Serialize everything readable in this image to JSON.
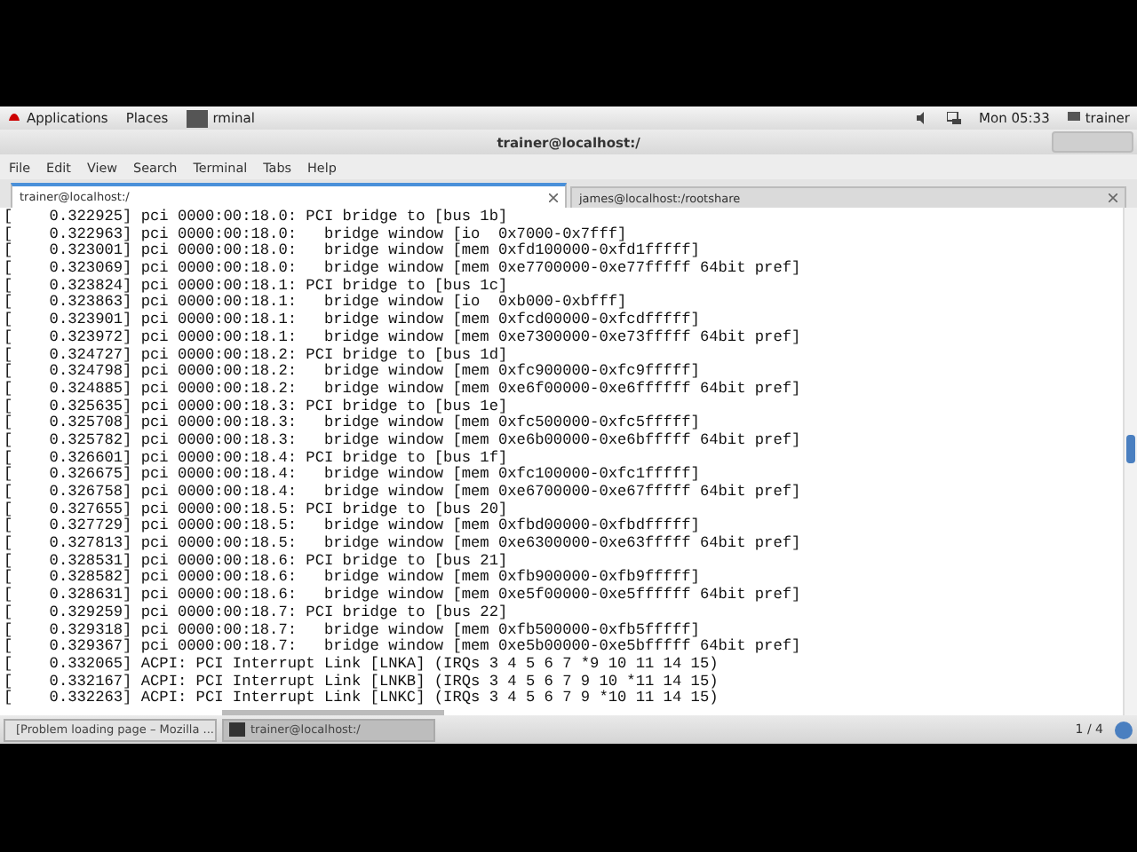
{
  "top_bar": {
    "applications": "Applications",
    "places": "Places",
    "active_app": "rminal",
    "clock": "Mon 05:33",
    "user": "trainer"
  },
  "window": {
    "title": "trainer@localhost:/"
  },
  "menu": [
    "File",
    "Edit",
    "View",
    "Search",
    "Terminal",
    "Tabs",
    "Help"
  ],
  "tabs": [
    {
      "label": "trainer@localhost:/",
      "selected": true
    },
    {
      "label": "james@localhost:/rootshare",
      "selected": false
    }
  ],
  "terminal_lines": [
    "[    0.322925] pci 0000:00:18.0: PCI bridge to [bus 1b]",
    "[    0.322963] pci 0000:00:18.0:   bridge window [io  0x7000-0x7fff]",
    "[    0.323001] pci 0000:00:18.0:   bridge window [mem 0xfd100000-0xfd1fffff]",
    "[    0.323069] pci 0000:00:18.0:   bridge window [mem 0xe7700000-0xe77fffff 64bit pref]",
    "[    0.323824] pci 0000:00:18.1: PCI bridge to [bus 1c]",
    "[    0.323863] pci 0000:00:18.1:   bridge window [io  0xb000-0xbfff]",
    "[    0.323901] pci 0000:00:18.1:   bridge window [mem 0xfcd00000-0xfcdfffff]",
    "[    0.323972] pci 0000:00:18.1:   bridge window [mem 0xe7300000-0xe73fffff 64bit pref]",
    "[    0.324727] pci 0000:00:18.2: PCI bridge to [bus 1d]",
    "[    0.324798] pci 0000:00:18.2:   bridge window [mem 0xfc900000-0xfc9fffff]",
    "[    0.324885] pci 0000:00:18.2:   bridge window [mem 0xe6f00000-0xe6ffffff 64bit pref]",
    "[    0.325635] pci 0000:00:18.3: PCI bridge to [bus 1e]",
    "[    0.325708] pci 0000:00:18.3:   bridge window [mem 0xfc500000-0xfc5fffff]",
    "[    0.325782] pci 0000:00:18.3:   bridge window [mem 0xe6b00000-0xe6bfffff 64bit pref]",
    "[    0.326601] pci 0000:00:18.4: PCI bridge to [bus 1f]",
    "[    0.326675] pci 0000:00:18.4:   bridge window [mem 0xfc100000-0xfc1fffff]",
    "[    0.326758] pci 0000:00:18.4:   bridge window [mem 0xe6700000-0xe67fffff 64bit pref]",
    "[    0.327655] pci 0000:00:18.5: PCI bridge to [bus 20]",
    "[    0.327729] pci 0000:00:18.5:   bridge window [mem 0xfbd00000-0xfbdfffff]",
    "[    0.327813] pci 0000:00:18.5:   bridge window [mem 0xe6300000-0xe63fffff 64bit pref]",
    "[    0.328531] pci 0000:00:18.6: PCI bridge to [bus 21]",
    "[    0.328582] pci 0000:00:18.6:   bridge window [mem 0xfb900000-0xfb9fffff]",
    "[    0.328631] pci 0000:00:18.6:   bridge window [mem 0xe5f00000-0xe5ffffff 64bit pref]",
    "[    0.329259] pci 0000:00:18.7: PCI bridge to [bus 22]",
    "[    0.329318] pci 0000:00:18.7:   bridge window [mem 0xfb500000-0xfb5fffff]",
    "[    0.329367] pci 0000:00:18.7:   bridge window [mem 0xe5b00000-0xe5bfffff 64bit pref]",
    "[    0.332065] ACPI: PCI Interrupt Link [LNKA] (IRQs 3 4 5 6 7 *9 10 11 14 15)",
    "[    0.332167] ACPI: PCI Interrupt Link [LNKB] (IRQs 3 4 5 6 7 9 10 *11 14 15)",
    "[    0.332263] ACPI: PCI Interrupt Link [LNKC] (IRQs 3 4 5 6 7 9 *10 11 14 15)"
  ],
  "taskbar": {
    "items": [
      {
        "label": "[Problem loading page – Mozilla ...",
        "kind": "browser",
        "selected": false
      },
      {
        "label": "trainer@localhost:/",
        "kind": "terminal",
        "selected": true
      }
    ],
    "pager": "1 / 4"
  }
}
